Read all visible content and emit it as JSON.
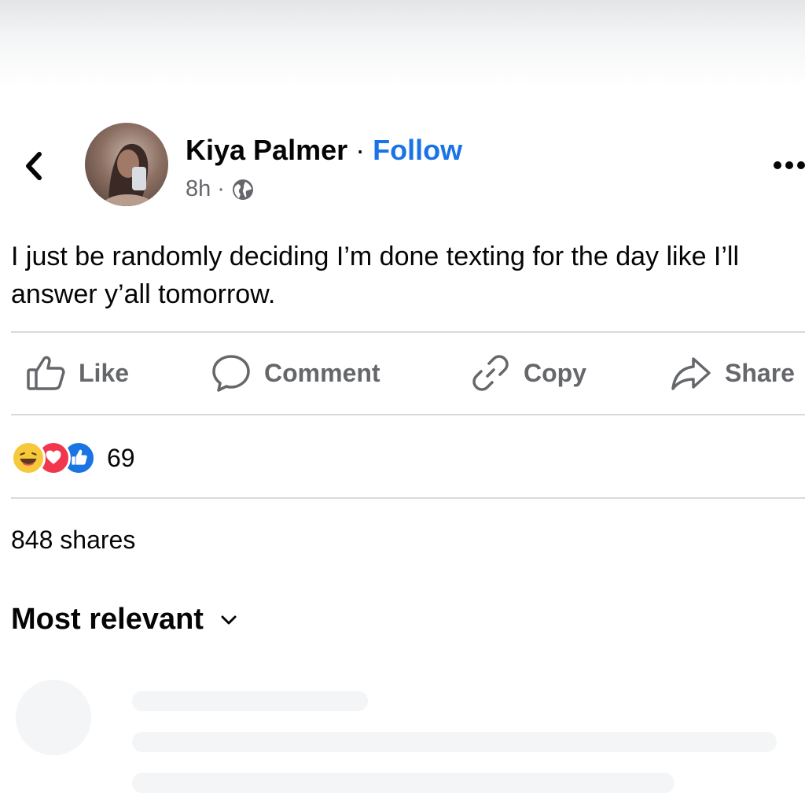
{
  "post": {
    "author": "Kiya Palmer",
    "separator": "·",
    "follow_label": "Follow",
    "time": "8h",
    "time_separator": "·",
    "text": "I just be randomly deciding I’m done texting for the day like I’ll answer y’all tomorrow."
  },
  "actions": {
    "like": "Like",
    "comment": "Comment",
    "copy": "Copy",
    "share": "Share"
  },
  "reactions": {
    "icons": [
      "haha-reaction-icon",
      "love-reaction-icon",
      "like-reaction-icon"
    ],
    "count": "69"
  },
  "shares": "848 shares",
  "comments": {
    "sort_label": "Most relevant"
  },
  "colors": {
    "follow": "#1b74e4",
    "muted": "#65676b",
    "text": "#050505"
  }
}
